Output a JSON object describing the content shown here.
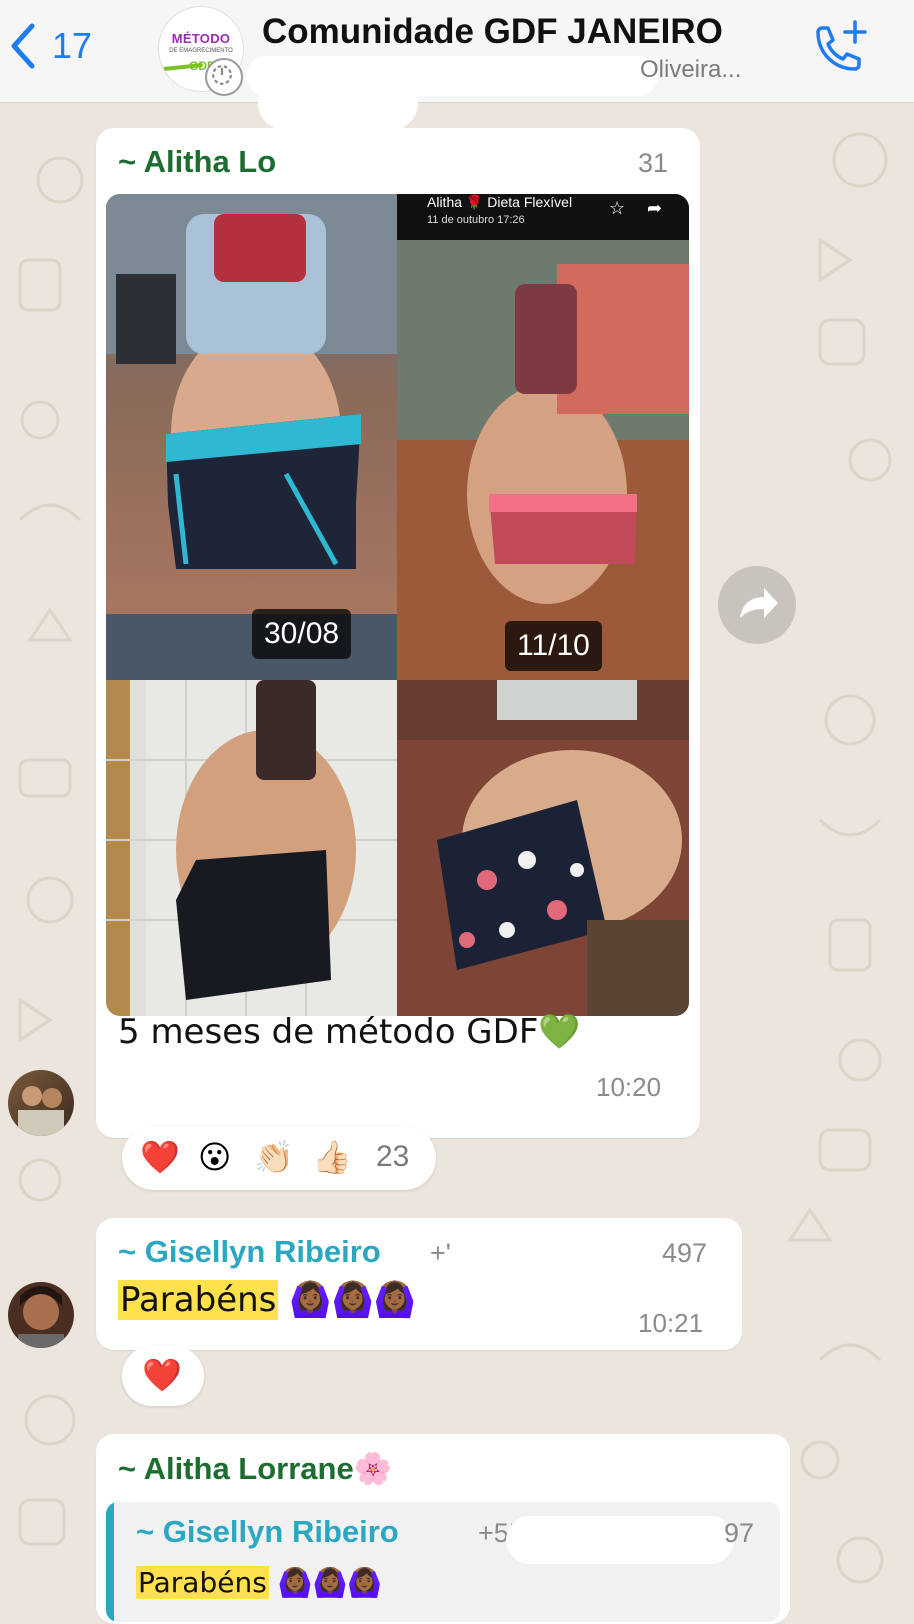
{
  "header": {
    "back_count": "17",
    "group_title": "Comunidade GDF JANEIRO",
    "members_preview": "Oliveira...",
    "group_logo": {
      "line1": "MÉTODO",
      "line2": "DE EMAGRECIMENTO",
      "line3": "GDF"
    }
  },
  "messages": [
    {
      "sender": "~ Alitha Lo",
      "phone_fragment": "31",
      "photo_labels": [
        "30/08",
        "11/10"
      ],
      "inner_caption_name": "Alitha",
      "inner_caption_title": "Dieta Flexível",
      "inner_caption_date": "11 de outubro 17:26",
      "text": "5 meses de método GDF",
      "text_emoji": "💚",
      "time": "10:20",
      "reactions": [
        "❤️",
        "😮",
        "👏🏻",
        "👍🏻"
      ],
      "reaction_count": "23"
    },
    {
      "sender": "~ Gisellyn Ribeiro",
      "phone_fragment": "+'",
      "phone_end": "497",
      "text": "Parabéns",
      "text_emoji": "🙆🏾‍♀️🙆🏾‍♀️🙆🏾‍♀️",
      "time": "10:21",
      "reactions": [
        "❤️"
      ]
    },
    {
      "sender": "~ Alitha Lorrane",
      "sender_emoji": "🌸",
      "quoted_sender": "~ Gisellyn Ribeiro",
      "quoted_phone": "+55",
      "quoted_phone_end": "97",
      "quoted_text": "Parabéns",
      "quoted_emoji": "🙆🏾‍♀️🙆🏾‍♀️🙆🏾‍♀️"
    }
  ],
  "colors": {
    "accent_blue": "#1e7cf2",
    "sender_green": "#1c6d2f",
    "sender_cyan": "#2ba7c1",
    "highlight": "#ffe14d",
    "chat_bg": "#ece5dd"
  },
  "icons": [
    "back-chevron-icon",
    "phone-add-icon",
    "forward-icon",
    "timer-icon"
  ]
}
